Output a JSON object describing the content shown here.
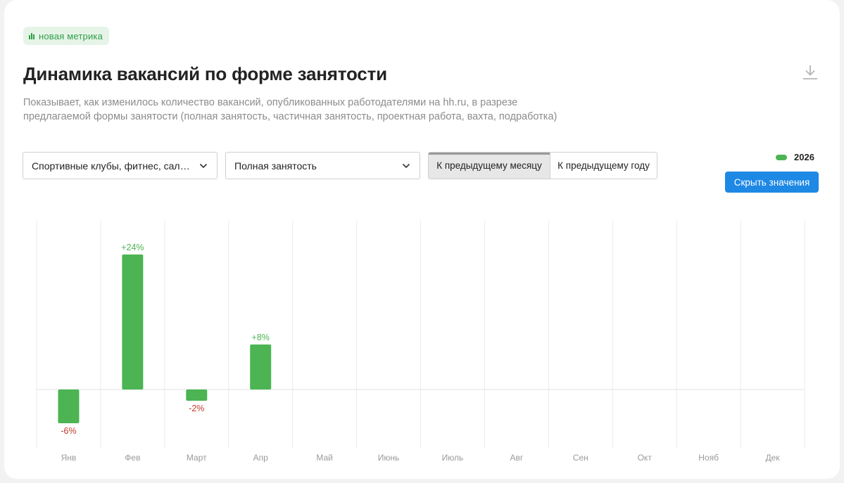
{
  "badge": {
    "icon": "bar-chart-icon",
    "label": "новая метрика"
  },
  "title": "Динамика вакансий по форме занятости",
  "description": "Показывает, как изменилось количество вакансий, опубликованных работодателями на hh.ru, в разрезе предлагаемой формы занятости (полная занятость, частичная занятость, проектная работа, вахта, подработка)",
  "download_icon": "download-icon",
  "filters": {
    "industry": "Спортивные клубы, фитнес, сало…",
    "employment": "Полная занятость"
  },
  "comparison": {
    "options": [
      "К предыдущему месяцу",
      "К предыдущему году"
    ],
    "selected": "К предыдущему месяцу"
  },
  "legend": {
    "label": "2026",
    "color": "#4cb452"
  },
  "hide_values_label": "Скрыть значения",
  "colors": {
    "bar": "#4cb452",
    "positive_label": "#4cb452",
    "negative_label": "#c0392b",
    "accent": "#1e88e5"
  },
  "chart_data": {
    "type": "bar",
    "categories": [
      "Янв",
      "Фев",
      "Март",
      "Апр",
      "Май",
      "Июнь",
      "Июль",
      "Авг",
      "Сен",
      "Окт",
      "Нояб",
      "Дек"
    ],
    "series": [
      {
        "name": "2026",
        "values": [
          -6,
          24,
          -2,
          8,
          null,
          null,
          null,
          null,
          null,
          null,
          null,
          null
        ]
      }
    ],
    "value_labels": [
      "-6%",
      "+24%",
      "-2%",
      "+8%",
      "",
      "",
      "",
      "",
      "",
      "",
      "",
      ""
    ],
    "ylim": [
      -10.5,
      30
    ],
    "grid": true
  }
}
